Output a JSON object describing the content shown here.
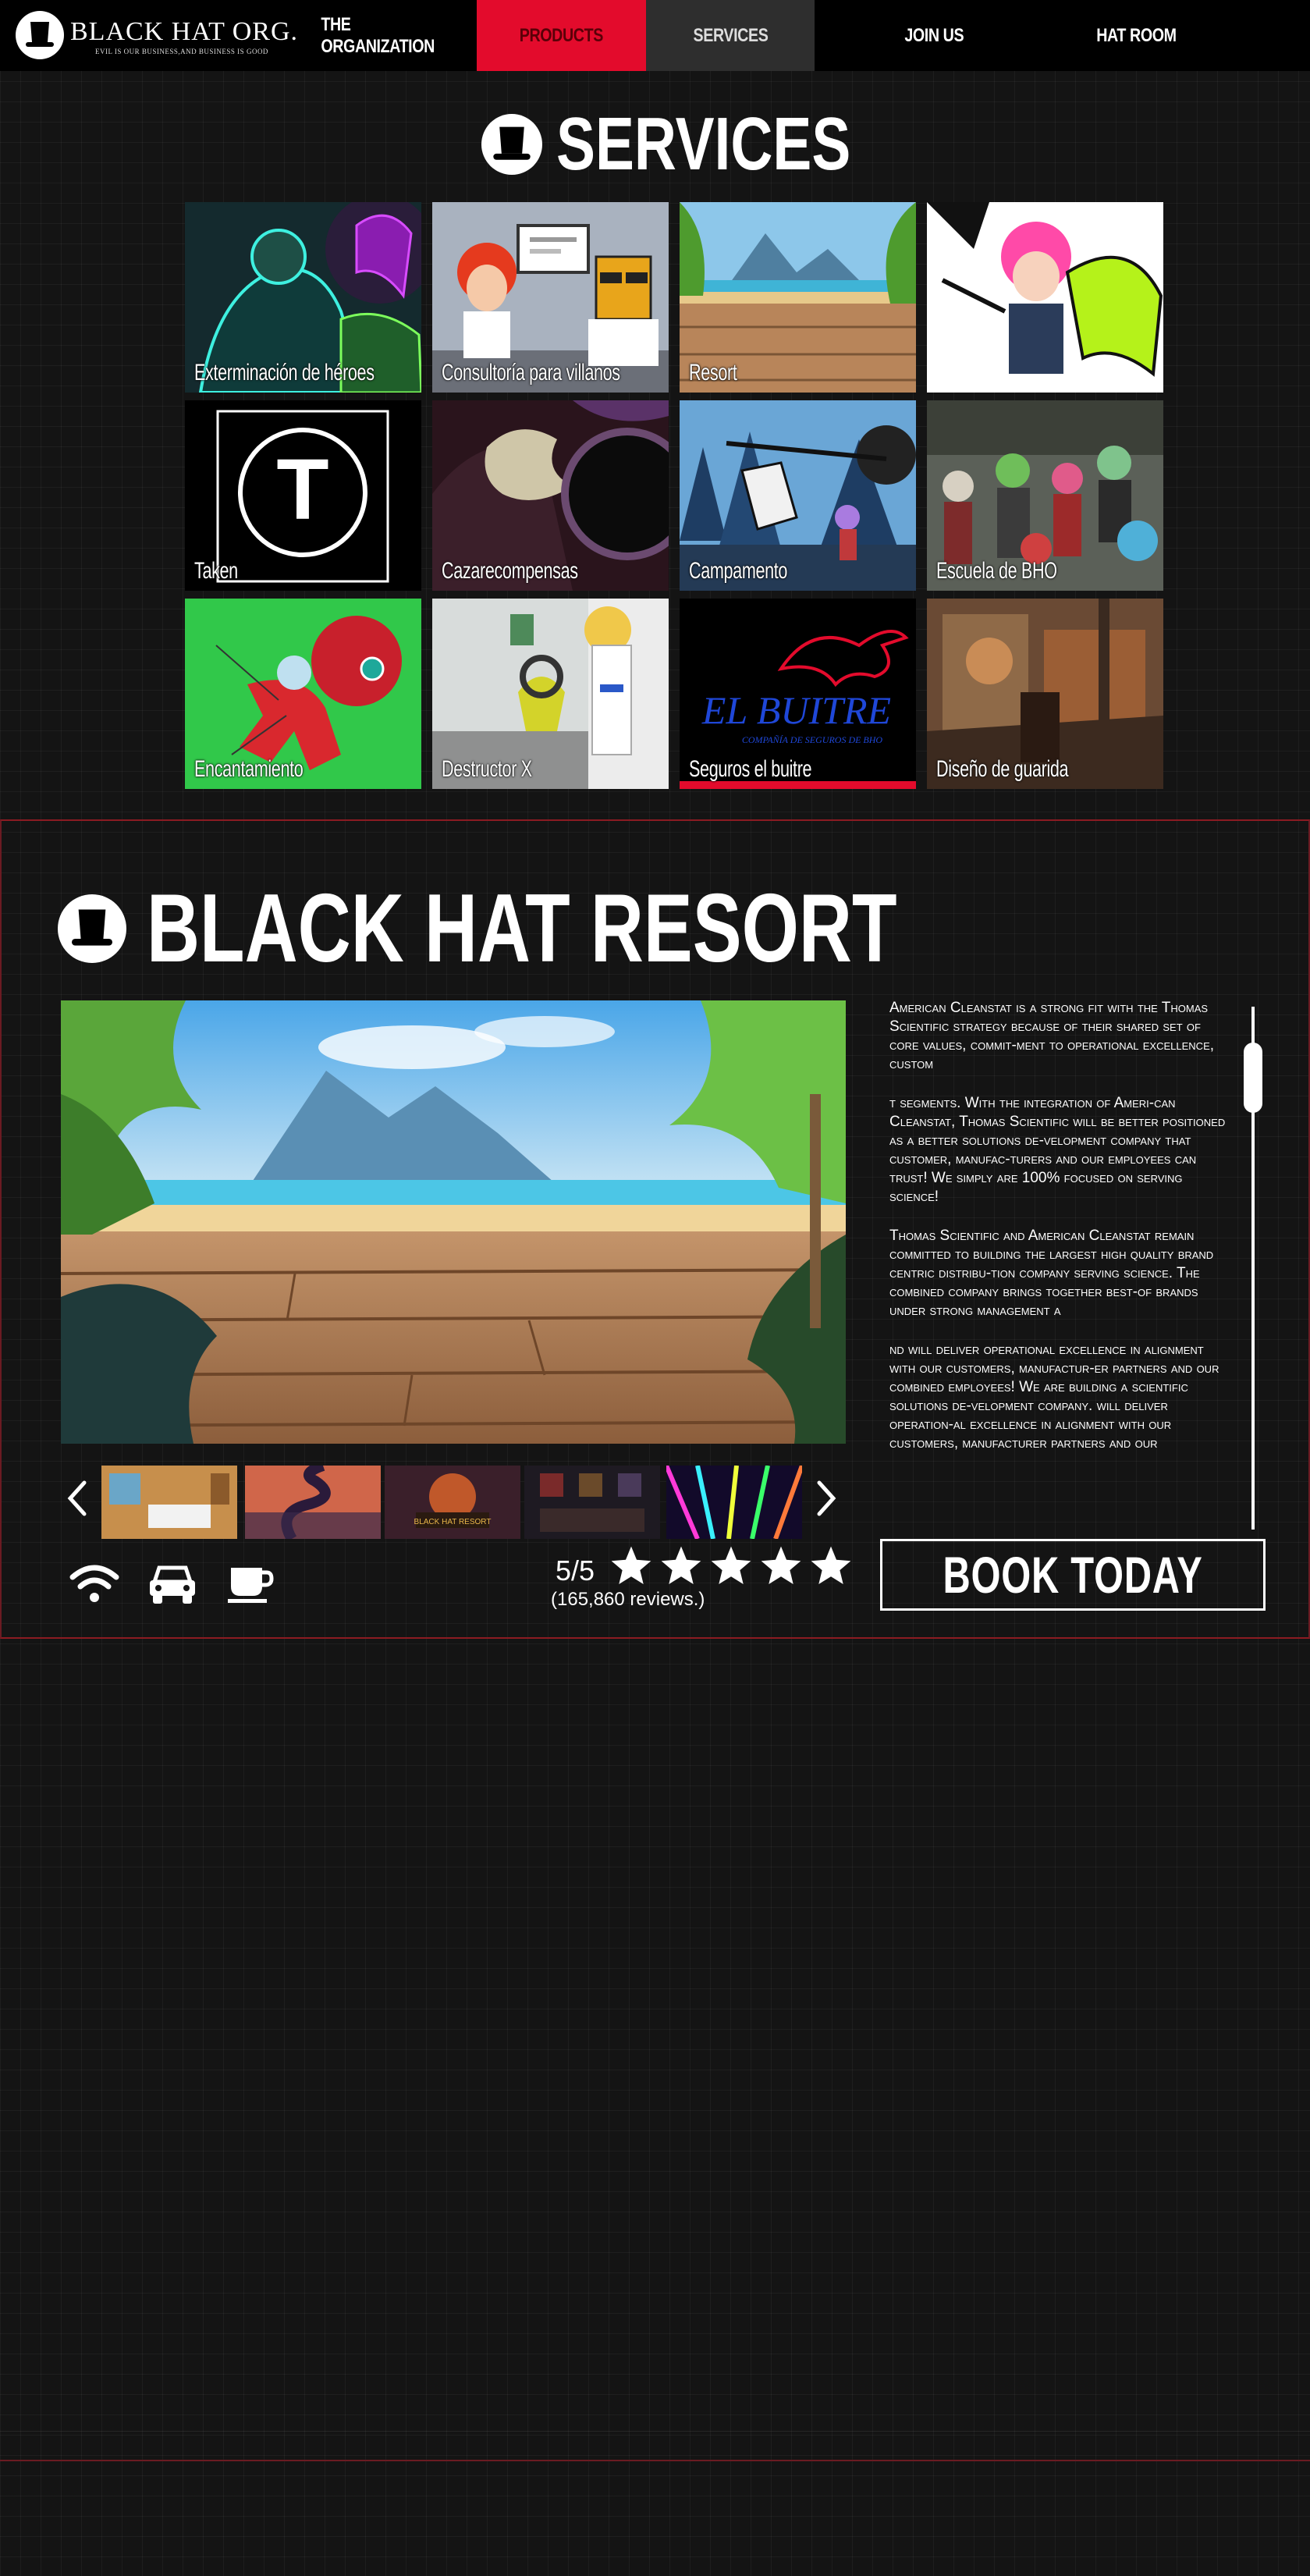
{
  "nav": {
    "logo_text": "BLACK HAT ORG.",
    "logo_tagline": "EVIL IS OUR BUSINESS,AND BUSINESS IS GOOD",
    "items": [
      {
        "label": "THE ORGANIZATION"
      },
      {
        "label": "PRODUCTS"
      },
      {
        "label": "SERVICES"
      },
      {
        "label": "JOIN US"
      },
      {
        "label": "HAT ROOM"
      }
    ]
  },
  "services": {
    "title": "SERVICES",
    "tiles": [
      {
        "label": "Exterminación de héroes"
      },
      {
        "label": "Consultoría para villanos"
      },
      {
        "label": "Resort"
      },
      {
        "label": ""
      },
      {
        "label": "Taken"
      },
      {
        "label": "Cazarecompensas"
      },
      {
        "label": "Campamento"
      },
      {
        "label": "Escuela de BHO"
      },
      {
        "label": "Encantamiento"
      },
      {
        "label": "Destructor X"
      },
      {
        "label": "Seguros el buitre"
      },
      {
        "label": "Diseño de guarida"
      }
    ],
    "buitre_brand": "EL BUITRE",
    "buitre_sub": "COMPAÑÍA DE SEGUROS DE BHO",
    "taken_letter": "T"
  },
  "resort": {
    "title": "BLACK HAT RESORT",
    "description": [
      "American Cleanstat is a strong fit with the Thomas Scientific strategy because of their shared set of core values, commit-ment to operational excellence, custom",
      "t segments. With the integration of Ameri-can Cleanstat, Thomas Scientific will be better positioned as a better solutions de-velopment company that customer, manufac-turers and our employees can trust! We simply are 100% focused on serving science!",
      "Thomas Scientific and American Cleanstat remain committed to building the largest high quality brand centric distribu-tion company serving science. The combined company brings together best-of brands under strong management a",
      "nd will deliver operational excellence in alignment with our customers, manufactur-er partners and our combined employees! We are building a scientific solutions de-velopment company. will deliver operation-al excellence in alignment with our customers, manufacturer partners and our"
    ],
    "rating_score": "5/5",
    "rating_count": "(165,860 reviews.)",
    "stars": 5,
    "book_label": "BOOK TODAY",
    "amenities": [
      "wifi-icon",
      "car-icon",
      "coffee-icon"
    ],
    "thumb_sign_text": "BLACK HAT RESORT"
  },
  "colors": {
    "accent": "#e30b2c",
    "nav_active": "#2e2e2e",
    "section_border": "#8b1b22"
  }
}
